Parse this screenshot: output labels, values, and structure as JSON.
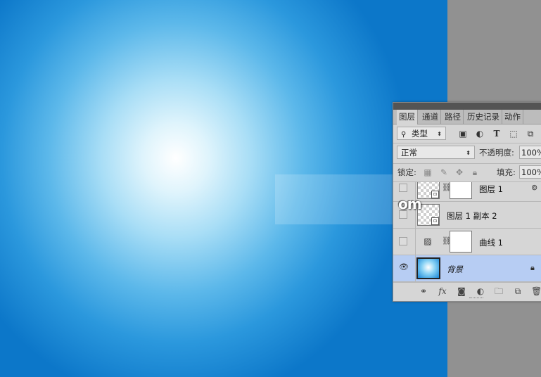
{
  "panel": {
    "tabs": [
      "图层",
      "通道",
      "路径",
      "历史记录",
      "动作"
    ],
    "filter": {
      "label": "类型",
      "icons": [
        "image-filter-icon",
        "adjustment-filter-icon",
        "type-filter-icon",
        "shape-filter-icon",
        "smart-object-filter-icon"
      ]
    },
    "blend_mode": "正常",
    "opacity_label": "不透明度:",
    "opacity_value": "100%",
    "lock_label": "锁定:",
    "fill_label": "填充:",
    "fill_value": "100%",
    "layers": [
      {
        "name": "图层 1",
        "visible": false
      },
      {
        "name": "图层 1 副本 2",
        "visible": false
      },
      {
        "name": "曲线 1",
        "visible": false
      },
      {
        "name": "背景",
        "visible": true,
        "locked": true,
        "selected": true
      }
    ],
    "footer_icons": [
      "link-layers-icon",
      "fx-icon",
      "mask-icon",
      "adjustment-icon",
      "group-icon",
      "new-layer-icon",
      "delete-icon"
    ],
    "fx_label": "fx"
  },
  "watermark": "om"
}
